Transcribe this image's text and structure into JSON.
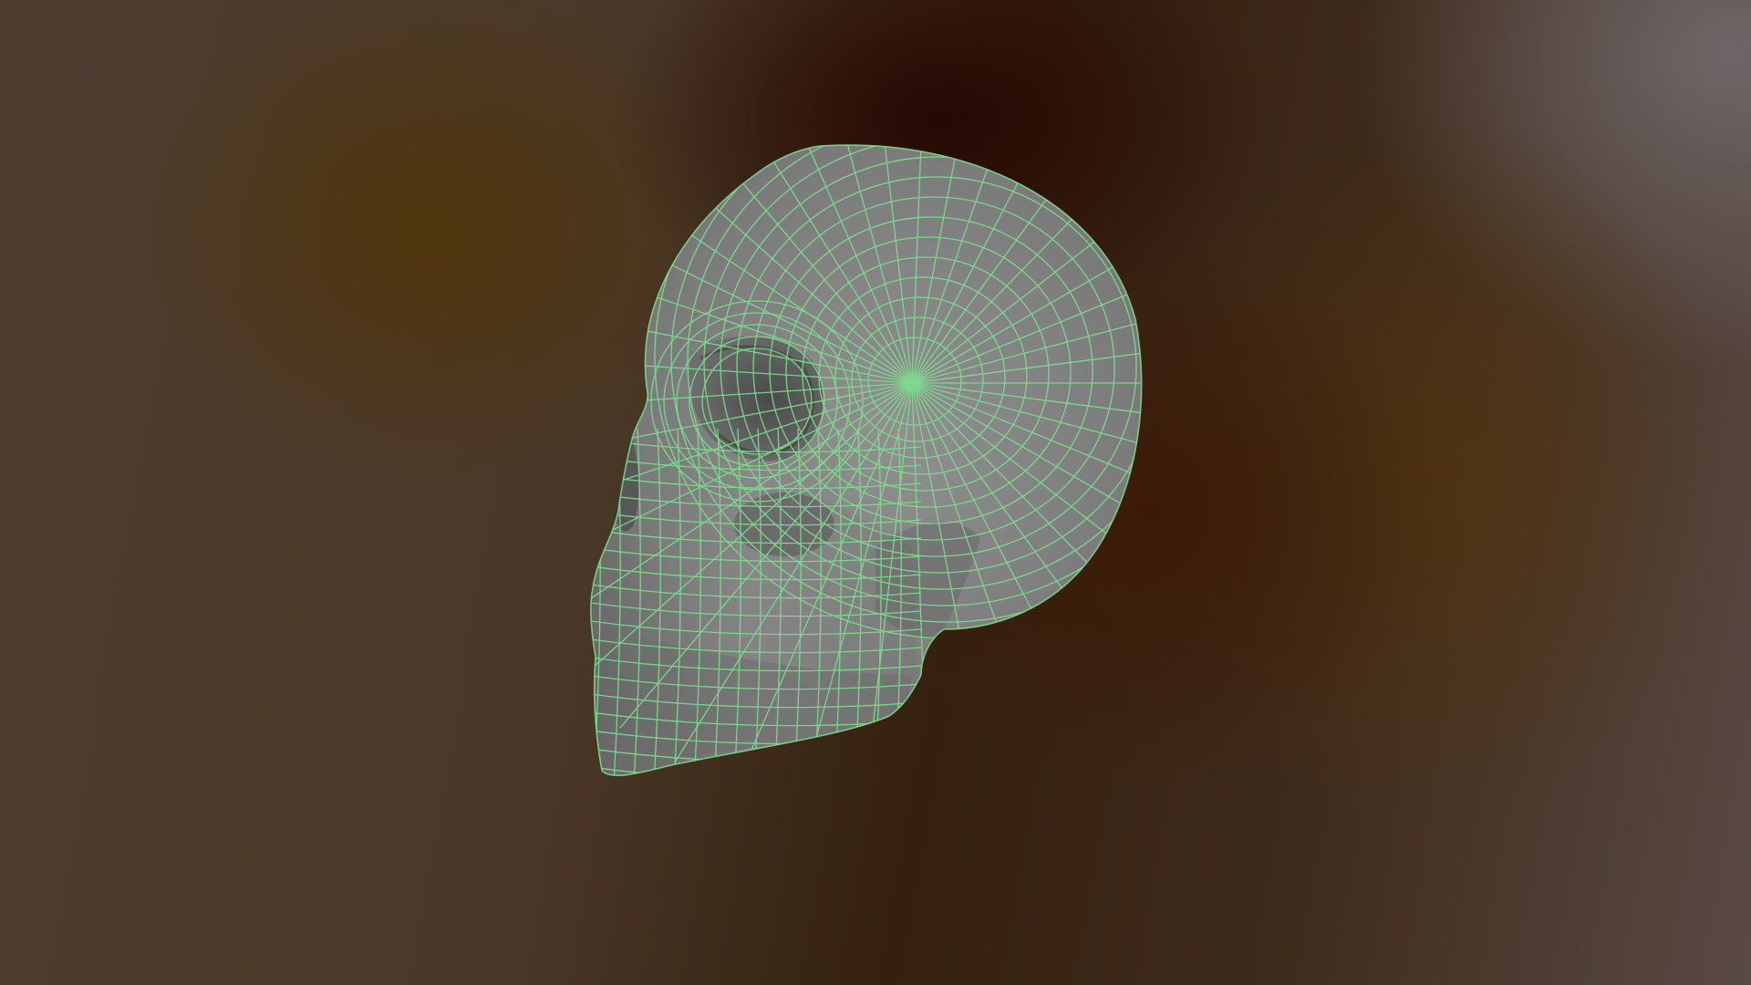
{
  "scene": {
    "subject": "skull-mesh",
    "render_mode": "shaded-wireframe",
    "colors": {
      "mesh_fill": "#8a8a8a",
      "mesh_shadow": "#5a5a5a",
      "wireframe": "#7fe08f",
      "background_dark": "#2a0806",
      "background_warm": "#4e3d30",
      "background_light": "#6e6868"
    }
  }
}
